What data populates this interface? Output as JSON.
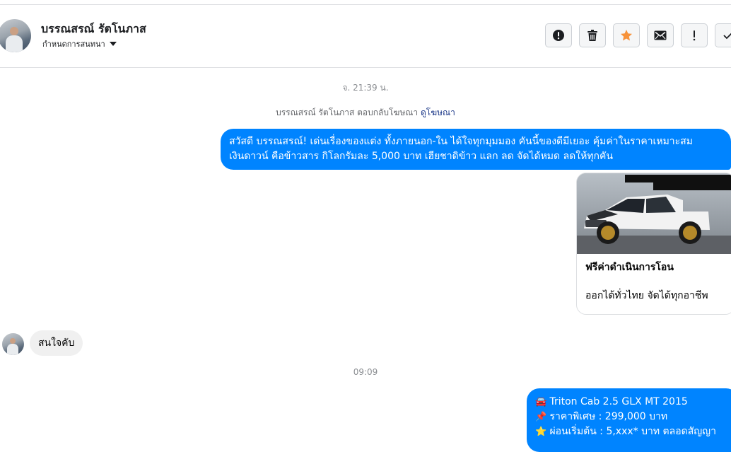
{
  "header": {
    "contact_name": "บรรณสรณ์ รัตโนภาส",
    "conversation_setting": "กำหนดการสนทนา",
    "actions": [
      {
        "name": "report-spam",
        "icon": "exclamation-circle-icon"
      },
      {
        "name": "delete",
        "icon": "trash-icon"
      },
      {
        "name": "star",
        "icon": "star-icon"
      },
      {
        "name": "mark-unread",
        "icon": "envelope-icon"
      },
      {
        "name": "important",
        "icon": "exclamation-icon"
      },
      {
        "name": "mark-done",
        "icon": "check-icon"
      }
    ]
  },
  "conversation": {
    "timestamp_1": "จ. 21:39 น.",
    "ad_reply_text": "บรรณสรณ์ รัตโนภาส ตอบกลับโฆษณา",
    "ad_reply_link": "ดูโฆษณา",
    "outgoing_1": {
      "line1": "สวัสดี บรรณสรณ์! เด่นเรื่องของแต่ง ทั้งภายนอก-ใน ได้ใจทุกมุมมอง คันนี้ของดีมีเยอะ คุ้มค่าในราคาเหมาะสม",
      "line2": "เงินดาวน์ คือข้าวสาร กิโลกรัมละ 5,000 บาท เฮียชาดิข้าว แลก ลด จัดได้หมด ลดให้ทุกคัน"
    },
    "ad_card": {
      "title": "ฟรีค่าดำเนินการโอน",
      "subtitle": "ออกได้ทั่วไทย จัดได้ทุกอาชีพ"
    },
    "incoming_1": "สนใจคับ",
    "timestamp_2": "09:09",
    "outgoing_2": {
      "line1": "Triton Cab 2.5 GLX MT 2015",
      "line2": "ราคาพิเศษ : 299,000 บาท",
      "line3": "ผ่อนเริ่มต้น : 5,xxx* บาท ตลอดสัญญา",
      "line1_icon": "car-emoji",
      "line2_icon": "pushpin-emoji",
      "line3_icon": "star-emoji"
    }
  },
  "colors": {
    "outgoing_bubble": "#0084ff",
    "incoming_bubble": "#f0f0f0",
    "star_accent": "#f7923a",
    "link": "#1e3a8a"
  }
}
